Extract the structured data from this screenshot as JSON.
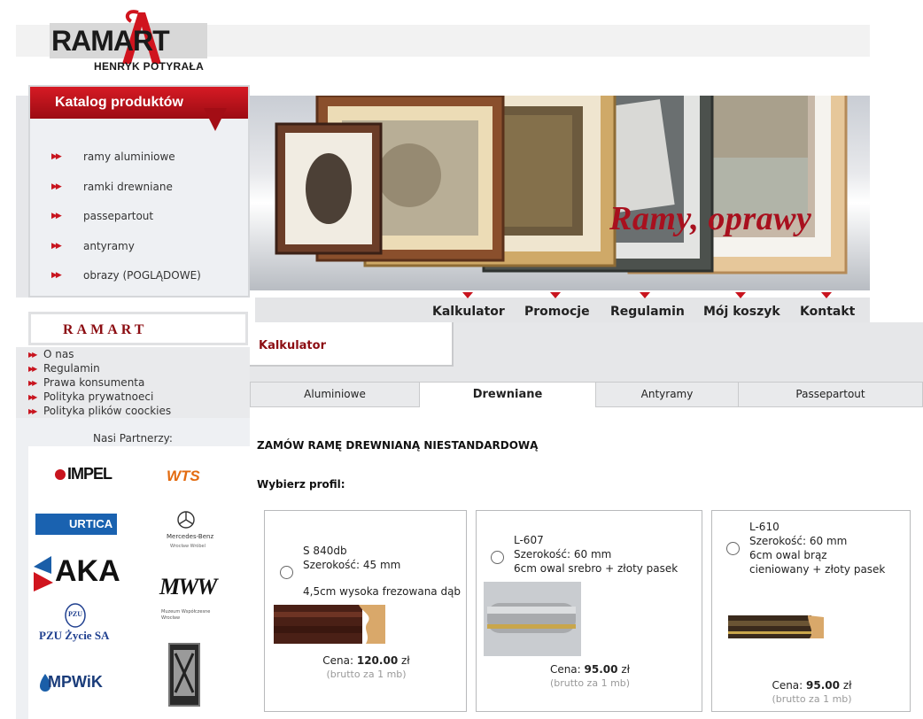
{
  "logo": {
    "name": "RAMART",
    "subtitle": "HENRYK POTYRAŁA"
  },
  "banner": {
    "slogan": "Ramy, oprawy"
  },
  "catalog": {
    "title": "Katalog produktów",
    "items": [
      {
        "label": "ramy aluminiowe"
      },
      {
        "label": "ramki drewniane"
      },
      {
        "label": "passepartout"
      },
      {
        "label": "antyramy"
      },
      {
        "label": "obrazy (POGLĄDOWE)"
      }
    ]
  },
  "nav": {
    "items": [
      {
        "label": "Kalkulator"
      },
      {
        "label": "Promocje"
      },
      {
        "label": "Regulamin"
      },
      {
        "label": "Mój koszyk"
      },
      {
        "label": "Kontakt"
      }
    ]
  },
  "ramart": {
    "title": "RAMART",
    "links": [
      {
        "label": "O nas"
      },
      {
        "label": "Regulamin"
      },
      {
        "label": "Prawa konsumenta"
      },
      {
        "label": "Polityka prywatnoeci"
      },
      {
        "label": "Polityka plików coockies"
      }
    ]
  },
  "partners": {
    "title": "Nasi Partnerzy:",
    "logos": [
      {
        "text": "IMPEL"
      },
      {
        "text": "WTS"
      },
      {
        "text": "URTICA"
      },
      {
        "text": "Mercedes-Benz"
      },
      {
        "text": "AKA"
      },
      {
        "text": "MWW"
      },
      {
        "text": "PZU Życie SA"
      },
      {
        "text": "MPWiK"
      }
    ],
    "captions": {
      "mercedes": "Mercedes-Benz",
      "mercedes_sub": "Wrocław Wróbel",
      "mww_sub": "Muzeum Współczesne Wrocław",
      "pzu_mark": "PZU"
    }
  },
  "content": {
    "active_section": "Kalkulator",
    "tabs": [
      {
        "label": "Aluminiowe"
      },
      {
        "label": "Drewniane"
      },
      {
        "label": "Antyramy"
      },
      {
        "label": "Passepartout"
      }
    ],
    "active_tab": "Drewniane",
    "heading": "ZAMÓW RAMĘ DREWNIANĄ NIESTANDARDOWĄ",
    "choose_label": "Wybierz profil:",
    "products": [
      {
        "code": "S 840db",
        "width": "Szerokość: 45 mm",
        "description": "4,5cm wysoka frezowana dąb",
        "price_label": "Cena:",
        "price": "120.00",
        "currency": "zł",
        "note": "(brutto za 1 mb)"
      },
      {
        "code": "L-607",
        "width": "Szerokość: 60 mm",
        "description": "6cm owal srebro + złoty pasek",
        "price_label": "Cena:",
        "price": "95.00",
        "currency": "zł",
        "note": "(brutto za 1 mb)"
      },
      {
        "code": "L-610",
        "width": "Szerokość: 60 mm",
        "description": "6cm owal brąz",
        "description2": "cieniowany + złoty pasek",
        "price_label": "Cena:",
        "price": "95.00",
        "currency": "zł",
        "note": "(brutto za 1 mb)"
      }
    ]
  },
  "colors": {
    "accent_red": "#c8141e",
    "dark_red": "#8c0d12"
  }
}
